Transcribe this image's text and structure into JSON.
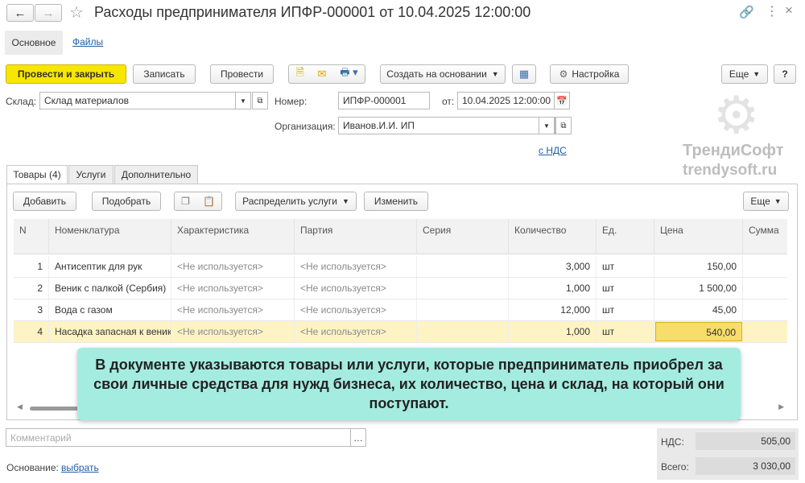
{
  "window": {
    "title": "Расходы предпринимателя ИПФР-000001 от 10.04.2025 12:00:00"
  },
  "nav": {
    "main_tab": "Основное",
    "files_tab": "Файлы"
  },
  "toolbar": {
    "post_close": "Провести и закрыть",
    "save": "Записать",
    "post": "Провести",
    "create_based": "Создать на основании",
    "settings": "Настройка",
    "more": "Еще",
    "help": "?"
  },
  "form": {
    "warehouse_label": "Склад:",
    "warehouse_value": "Склад материалов",
    "number_label": "Номер:",
    "number_value": "ИПФР-000001",
    "date_label": "от:",
    "date_value": "10.04.2025 12:00:00",
    "org_label": "Организация:",
    "org_value": "Иванов.И.И. ИП",
    "vat_link": "с НДС"
  },
  "watermark": {
    "name": "ТрендиСофт",
    "site": "trendysoft.ru"
  },
  "tabs": [
    {
      "label": "Товары (4)"
    },
    {
      "label": "Услуги"
    },
    {
      "label": "Дополнительно"
    }
  ],
  "table_toolbar": {
    "add": "Добавить",
    "pick": "Подобрать",
    "distribute": "Распределить услуги",
    "change": "Изменить",
    "more": "Еще"
  },
  "table": {
    "columns": [
      "N",
      "Номенклатура",
      "Характеристика",
      "Партия",
      "Серия",
      "Количество",
      "Ед.",
      "Цена",
      "Сумма"
    ],
    "rows": [
      {
        "n": "1",
        "name": "Антисептик для рук",
        "char": "<Не используется>",
        "batch": "<Не используется>",
        "series": "",
        "qty": "3,000",
        "unit": "шт",
        "price": "150,00"
      },
      {
        "n": "2",
        "name": "Веник с палкой (Сербия)",
        "char": "<Не используется>",
        "batch": "<Не используется>",
        "series": "",
        "qty": "1,000",
        "unit": "шт",
        "price": "1 500,00"
      },
      {
        "n": "3",
        "name": "Вода с газом",
        "char": "<Не используется>",
        "batch": "<Не используется>",
        "series": "",
        "qty": "12,000",
        "unit": "шт",
        "price": "45,00"
      },
      {
        "n": "4",
        "name": "Насадка запасная к венику",
        "char": "<Не используется>",
        "batch": "<Не используется>",
        "series": "",
        "qty": "1,000",
        "unit": "шт",
        "price": "540,00"
      }
    ]
  },
  "callout": {
    "text": "В документе указываются товары или услуги, которые предприниматель приобрел за свои личные средства для нужд бизнеса, их количество, цена и склад, на который они поступают."
  },
  "footer": {
    "comment_placeholder": "Комментарий",
    "basis_label": "Основание:",
    "basis_link": "выбрать",
    "vat_label": "НДС:",
    "vat_value": "505,00",
    "total_label": "Всего:",
    "total_value": "3 030,00"
  },
  "colors": {
    "primary_button": "#f7e600",
    "selected_row": "#fdf3c5",
    "selected_cell": "#f8dd6a",
    "callout": "#a5ece0",
    "link": "#1f5ea7"
  }
}
